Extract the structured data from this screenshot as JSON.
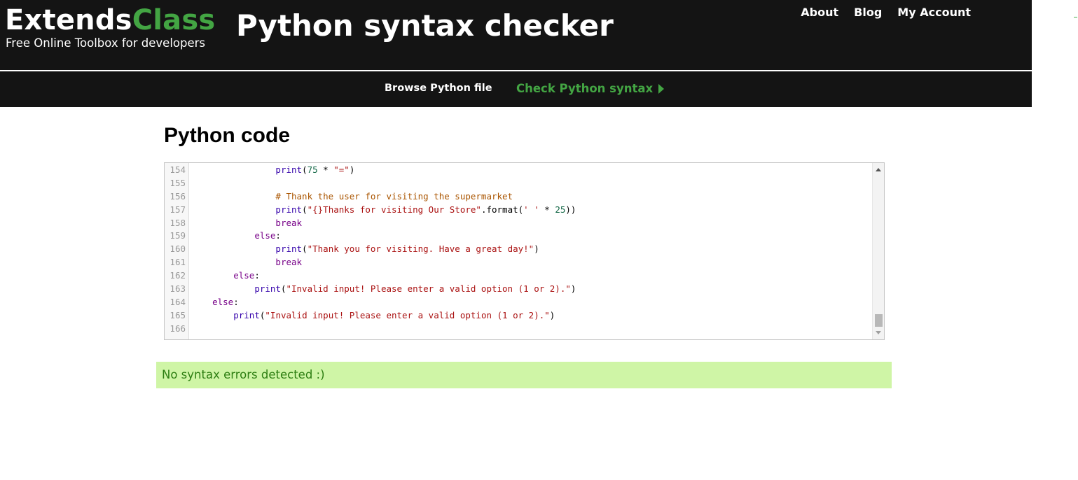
{
  "header": {
    "logo_part1": "Extends",
    "logo_part2": "Class",
    "tagline": "Free Online Toolbox for developers",
    "page_title": "Python syntax checker",
    "nav": [
      "About",
      "Blog",
      "My Account"
    ]
  },
  "toolbar": {
    "browse_label": "Browse Python file",
    "check_label": "Check Python syntax",
    "check_icon": "play-triangle-icon"
  },
  "editor": {
    "heading": "Python code",
    "language": "python",
    "lines": [
      {
        "num": "154",
        "indent": 16,
        "tokens": [
          {
            "t": "print",
            "c": "bi"
          },
          {
            "t": "(",
            "c": ""
          },
          {
            "t": "75",
            "c": "num"
          },
          {
            "t": " * ",
            "c": ""
          },
          {
            "t": "\"=\"",
            "c": "str"
          },
          {
            "t": ")",
            "c": ""
          }
        ]
      },
      {
        "num": "155",
        "indent": 0,
        "tokens": []
      },
      {
        "num": "156",
        "indent": 16,
        "tokens": [
          {
            "t": "# Thank the user for visiting the supermarket",
            "c": "cmt"
          }
        ]
      },
      {
        "num": "157",
        "indent": 16,
        "tokens": [
          {
            "t": "print",
            "c": "bi"
          },
          {
            "t": "(",
            "c": ""
          },
          {
            "t": "\"{}Thanks for visiting Our Store\"",
            "c": "str"
          },
          {
            "t": ".format(",
            "c": ""
          },
          {
            "t": "' '",
            "c": "str"
          },
          {
            "t": " * ",
            "c": ""
          },
          {
            "t": "25",
            "c": "num"
          },
          {
            "t": "))",
            "c": ""
          }
        ]
      },
      {
        "num": "158",
        "indent": 16,
        "tokens": [
          {
            "t": "break",
            "c": "kw"
          }
        ]
      },
      {
        "num": "159",
        "indent": 12,
        "tokens": [
          {
            "t": "else",
            "c": "kw"
          },
          {
            "t": ":",
            "c": ""
          }
        ]
      },
      {
        "num": "160",
        "indent": 16,
        "tokens": [
          {
            "t": "print",
            "c": "bi"
          },
          {
            "t": "(",
            "c": ""
          },
          {
            "t": "\"Thank you for visiting. Have a great day!\"",
            "c": "str"
          },
          {
            "t": ")",
            "c": ""
          }
        ]
      },
      {
        "num": "161",
        "indent": 16,
        "tokens": [
          {
            "t": "break",
            "c": "kw"
          }
        ]
      },
      {
        "num": "162",
        "indent": 8,
        "tokens": [
          {
            "t": "else",
            "c": "kw"
          },
          {
            "t": ":",
            "c": ""
          }
        ]
      },
      {
        "num": "163",
        "indent": 12,
        "tokens": [
          {
            "t": "print",
            "c": "bi"
          },
          {
            "t": "(",
            "c": ""
          },
          {
            "t": "\"Invalid input! Please enter a valid option (1 or 2).\"",
            "c": "str"
          },
          {
            "t": ")",
            "c": ""
          }
        ]
      },
      {
        "num": "164",
        "indent": 4,
        "tokens": [
          {
            "t": "else",
            "c": "kw"
          },
          {
            "t": ":",
            "c": ""
          }
        ]
      },
      {
        "num": "165",
        "indent": 8,
        "tokens": [
          {
            "t": "print",
            "c": "bi"
          },
          {
            "t": "(",
            "c": ""
          },
          {
            "t": "\"Invalid input! Please enter a valid option (1 or 2).\"",
            "c": "str"
          },
          {
            "t": ")",
            "c": ""
          }
        ]
      },
      {
        "num": "166",
        "indent": 0,
        "tokens": []
      }
    ]
  },
  "result": {
    "message": "No syntax errors detected :)",
    "status": "success"
  },
  "colors": {
    "brand_green": "#43a543",
    "header_bg": "#141414",
    "result_bg": "#cff5a6",
    "result_text": "#2d7e12"
  }
}
